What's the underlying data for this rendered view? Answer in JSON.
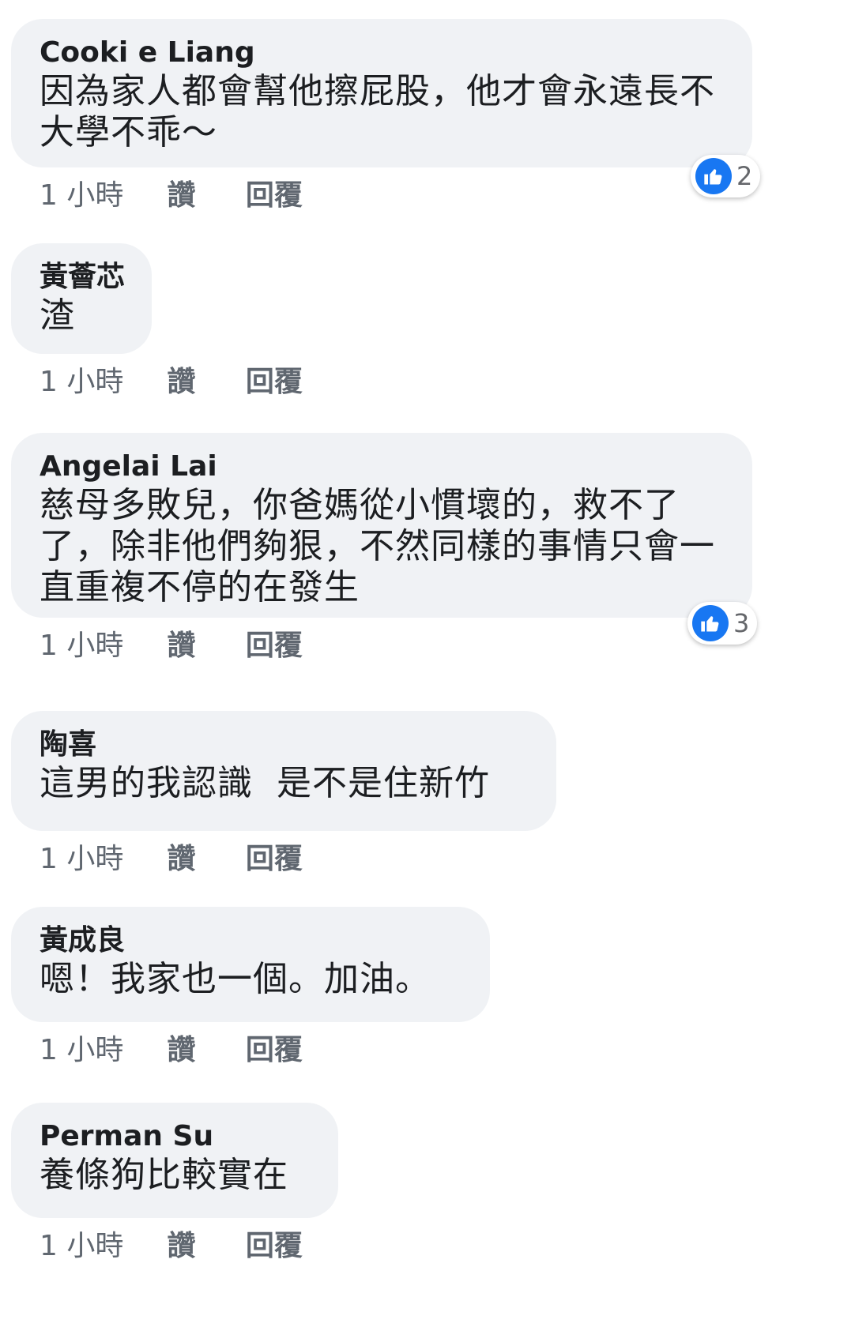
{
  "actions": {
    "like_label": "讚",
    "reply_label": "回覆"
  },
  "comments": [
    {
      "author": "Cooki e Liang",
      "lines": [
        "因為家人都會幫他擦屁股，他才會永遠長不",
        "大學不乖～"
      ],
      "time": "1 小時",
      "reactions": {
        "icon": "thumbs-up-icon",
        "count": "2"
      }
    },
    {
      "author": "黃薈芯",
      "lines": [
        "渣"
      ],
      "time": "1 小時"
    },
    {
      "author": "Angelai Lai",
      "lines": [
        "慈母多敗兒，你爸媽從小慣壞的，救不了",
        "了，除非他們夠狠，不然同樣的事情只會一",
        "直重複不停的在發生"
      ],
      "time": "1 小時",
      "reactions": {
        "icon": "thumbs-up-icon",
        "count": "3"
      }
    },
    {
      "author": "陶喜",
      "lines": [
        "這男的我認識  是不是住新竹"
      ],
      "time": "1 小時"
    },
    {
      "author": "黃成良",
      "lines": [
        "嗯！我家也一個。加油。"
      ],
      "time": "1 小時"
    },
    {
      "author": "Perman Su",
      "lines": [
        "養條狗比較實在"
      ],
      "time": "1 小時"
    }
  ],
  "colors": {
    "bubble_bg": "#f0f2f5",
    "like_blue": "#1877f2",
    "meta_text": "#606770"
  }
}
